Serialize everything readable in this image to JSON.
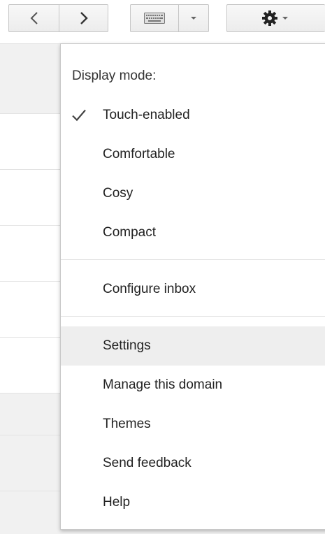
{
  "toolbar": {
    "prev_icon": "chevron-left-icon",
    "next_icon": "chevron-right-icon",
    "keyboard_icon": "keyboard-icon",
    "settings_icon": "gear-icon"
  },
  "menu": {
    "display_mode_heading": "Display mode:",
    "display_modes": [
      {
        "label": "Touch-enabled",
        "checked": true
      },
      {
        "label": "Comfortable",
        "checked": false
      },
      {
        "label": "Cosy",
        "checked": false
      },
      {
        "label": "Compact",
        "checked": false
      }
    ],
    "configure_inbox": "Configure inbox",
    "settings": "Settings",
    "manage_domain": "Manage this domain",
    "themes": "Themes",
    "send_feedback": "Send feedback",
    "help": "Help"
  },
  "colors": {
    "hover_background": "#eeeeee",
    "border": "#c6c6c6",
    "text": "#222222"
  }
}
